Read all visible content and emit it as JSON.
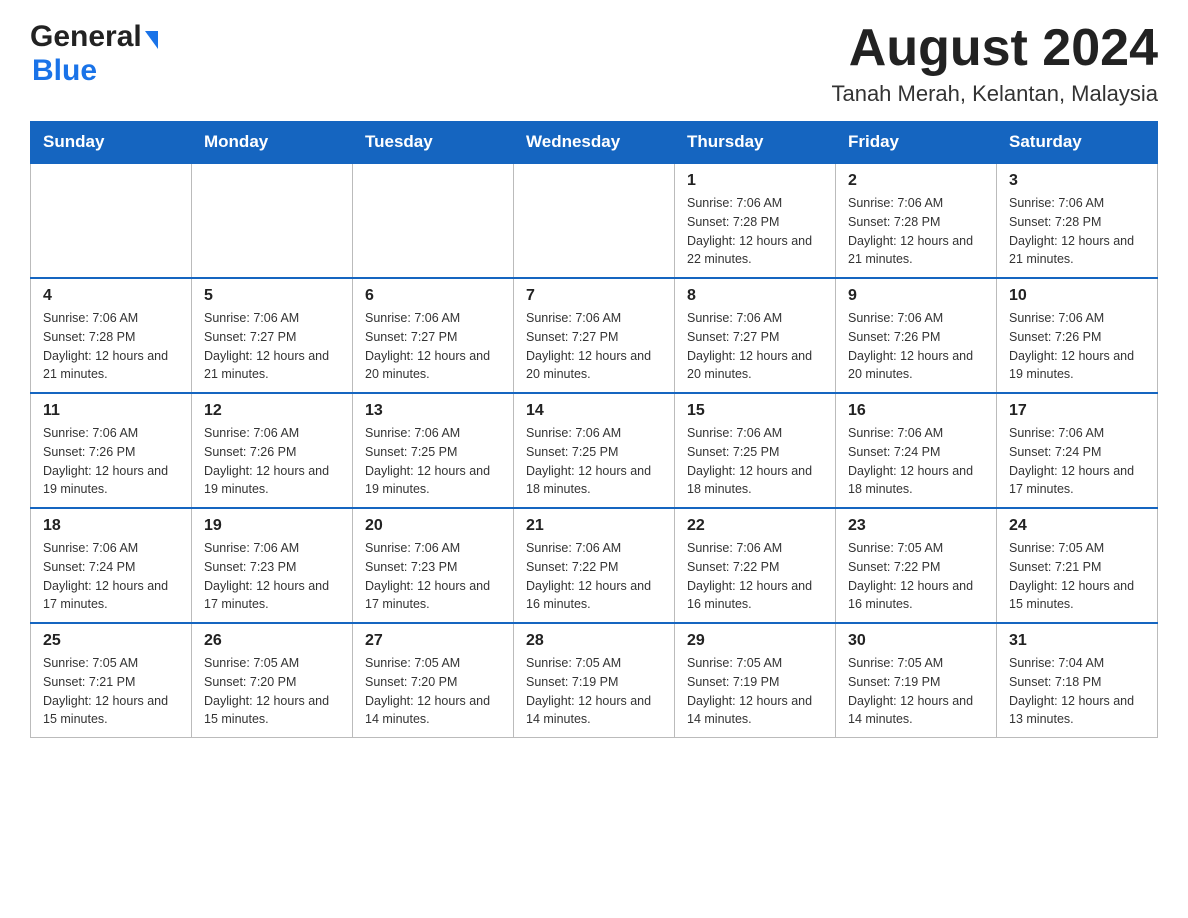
{
  "header": {
    "logo_general": "General",
    "logo_blue": "Blue",
    "month_title": "August 2024",
    "location": "Tanah Merah, Kelantan, Malaysia"
  },
  "days_of_week": [
    "Sunday",
    "Monday",
    "Tuesday",
    "Wednesday",
    "Thursday",
    "Friday",
    "Saturday"
  ],
  "weeks": [
    [
      {
        "day": "",
        "info": ""
      },
      {
        "day": "",
        "info": ""
      },
      {
        "day": "",
        "info": ""
      },
      {
        "day": "",
        "info": ""
      },
      {
        "day": "1",
        "info": "Sunrise: 7:06 AM\nSunset: 7:28 PM\nDaylight: 12 hours and 22 minutes."
      },
      {
        "day": "2",
        "info": "Sunrise: 7:06 AM\nSunset: 7:28 PM\nDaylight: 12 hours and 21 minutes."
      },
      {
        "day": "3",
        "info": "Sunrise: 7:06 AM\nSunset: 7:28 PM\nDaylight: 12 hours and 21 minutes."
      }
    ],
    [
      {
        "day": "4",
        "info": "Sunrise: 7:06 AM\nSunset: 7:28 PM\nDaylight: 12 hours and 21 minutes."
      },
      {
        "day": "5",
        "info": "Sunrise: 7:06 AM\nSunset: 7:27 PM\nDaylight: 12 hours and 21 minutes."
      },
      {
        "day": "6",
        "info": "Sunrise: 7:06 AM\nSunset: 7:27 PM\nDaylight: 12 hours and 20 minutes."
      },
      {
        "day": "7",
        "info": "Sunrise: 7:06 AM\nSunset: 7:27 PM\nDaylight: 12 hours and 20 minutes."
      },
      {
        "day": "8",
        "info": "Sunrise: 7:06 AM\nSunset: 7:27 PM\nDaylight: 12 hours and 20 minutes."
      },
      {
        "day": "9",
        "info": "Sunrise: 7:06 AM\nSunset: 7:26 PM\nDaylight: 12 hours and 20 minutes."
      },
      {
        "day": "10",
        "info": "Sunrise: 7:06 AM\nSunset: 7:26 PM\nDaylight: 12 hours and 19 minutes."
      }
    ],
    [
      {
        "day": "11",
        "info": "Sunrise: 7:06 AM\nSunset: 7:26 PM\nDaylight: 12 hours and 19 minutes."
      },
      {
        "day": "12",
        "info": "Sunrise: 7:06 AM\nSunset: 7:26 PM\nDaylight: 12 hours and 19 minutes."
      },
      {
        "day": "13",
        "info": "Sunrise: 7:06 AM\nSunset: 7:25 PM\nDaylight: 12 hours and 19 minutes."
      },
      {
        "day": "14",
        "info": "Sunrise: 7:06 AM\nSunset: 7:25 PM\nDaylight: 12 hours and 18 minutes."
      },
      {
        "day": "15",
        "info": "Sunrise: 7:06 AM\nSunset: 7:25 PM\nDaylight: 12 hours and 18 minutes."
      },
      {
        "day": "16",
        "info": "Sunrise: 7:06 AM\nSunset: 7:24 PM\nDaylight: 12 hours and 18 minutes."
      },
      {
        "day": "17",
        "info": "Sunrise: 7:06 AM\nSunset: 7:24 PM\nDaylight: 12 hours and 17 minutes."
      }
    ],
    [
      {
        "day": "18",
        "info": "Sunrise: 7:06 AM\nSunset: 7:24 PM\nDaylight: 12 hours and 17 minutes."
      },
      {
        "day": "19",
        "info": "Sunrise: 7:06 AM\nSunset: 7:23 PM\nDaylight: 12 hours and 17 minutes."
      },
      {
        "day": "20",
        "info": "Sunrise: 7:06 AM\nSunset: 7:23 PM\nDaylight: 12 hours and 17 minutes."
      },
      {
        "day": "21",
        "info": "Sunrise: 7:06 AM\nSunset: 7:22 PM\nDaylight: 12 hours and 16 minutes."
      },
      {
        "day": "22",
        "info": "Sunrise: 7:06 AM\nSunset: 7:22 PM\nDaylight: 12 hours and 16 minutes."
      },
      {
        "day": "23",
        "info": "Sunrise: 7:05 AM\nSunset: 7:22 PM\nDaylight: 12 hours and 16 minutes."
      },
      {
        "day": "24",
        "info": "Sunrise: 7:05 AM\nSunset: 7:21 PM\nDaylight: 12 hours and 15 minutes."
      }
    ],
    [
      {
        "day": "25",
        "info": "Sunrise: 7:05 AM\nSunset: 7:21 PM\nDaylight: 12 hours and 15 minutes."
      },
      {
        "day": "26",
        "info": "Sunrise: 7:05 AM\nSunset: 7:20 PM\nDaylight: 12 hours and 15 minutes."
      },
      {
        "day": "27",
        "info": "Sunrise: 7:05 AM\nSunset: 7:20 PM\nDaylight: 12 hours and 14 minutes."
      },
      {
        "day": "28",
        "info": "Sunrise: 7:05 AM\nSunset: 7:19 PM\nDaylight: 12 hours and 14 minutes."
      },
      {
        "day": "29",
        "info": "Sunrise: 7:05 AM\nSunset: 7:19 PM\nDaylight: 12 hours and 14 minutes."
      },
      {
        "day": "30",
        "info": "Sunrise: 7:05 AM\nSunset: 7:19 PM\nDaylight: 12 hours and 14 minutes."
      },
      {
        "day": "31",
        "info": "Sunrise: 7:04 AM\nSunset: 7:18 PM\nDaylight: 12 hours and 13 minutes."
      }
    ]
  ]
}
